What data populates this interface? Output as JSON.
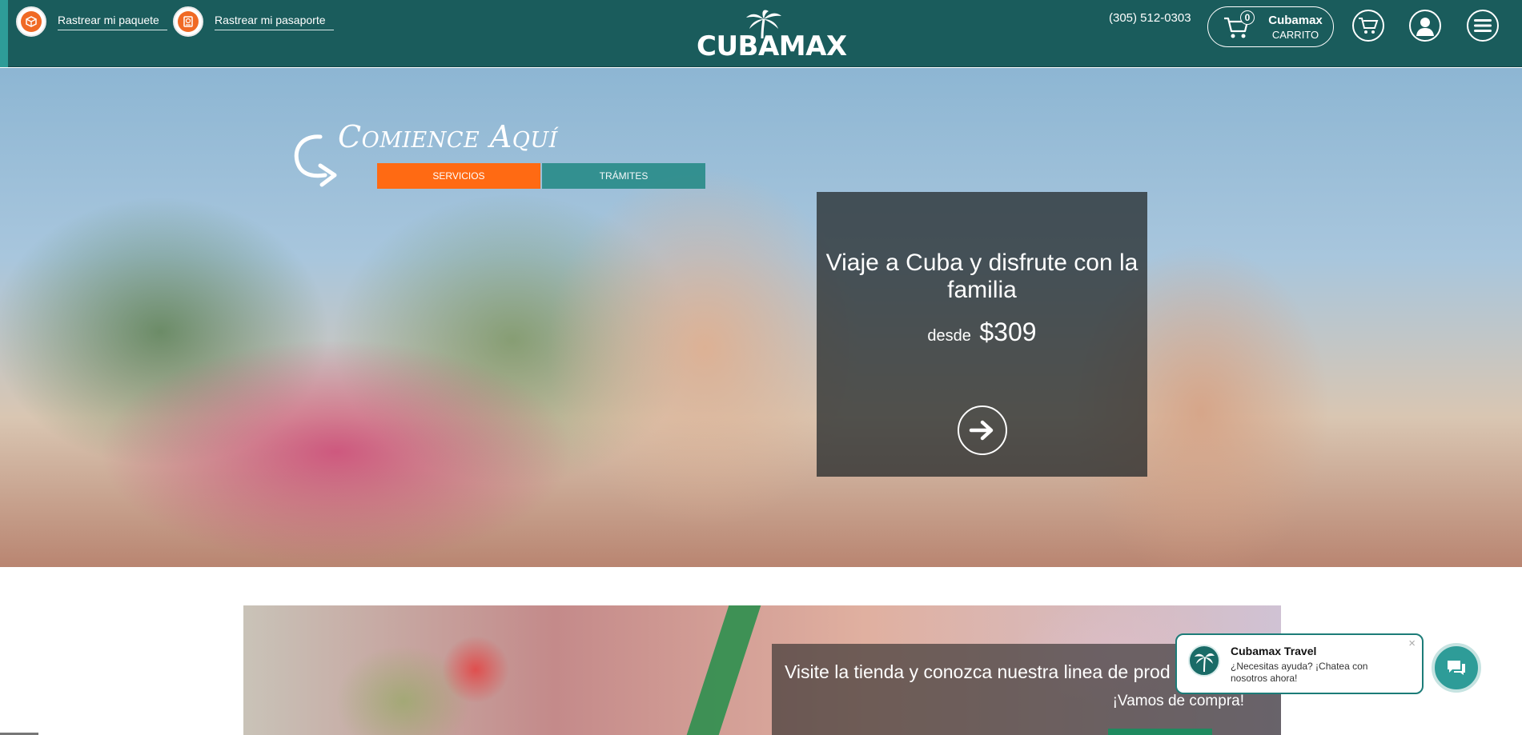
{
  "header": {
    "track_package": "Rastrear mi paquete",
    "track_passport": "Rastrear mi pasaporte",
    "logo": "CUBAMAX",
    "phone": "(305) 512-0303",
    "cart": {
      "count": "0",
      "title": "Cubamax",
      "subtitle": "CARRITO"
    },
    "icons": [
      "cart-icon",
      "user-icon",
      "menu-icon"
    ]
  },
  "hero": {
    "start_heading": "Comience Aquí",
    "tabs": [
      {
        "label": "SERVICIOS"
      },
      {
        "label": "TRÁMITES"
      }
    ],
    "promo": {
      "title": "Viaje a Cuba y disfrute con la familia",
      "from_label": "desde",
      "price": "$309"
    }
  },
  "store": {
    "title": "Visite la tienda y conozca nuestra linea de prod",
    "subtitle": "¡Vamos de compra!"
  },
  "chat": {
    "name": "Cubamax Travel",
    "message": "¿Necesitas ayuda? ¡Chatea con nosotros ahora!",
    "close": "×"
  },
  "colors": {
    "header_bg": "#1a5c5c",
    "accent_orange": "#ff6a13",
    "accent_teal": "#2b8d8a"
  }
}
